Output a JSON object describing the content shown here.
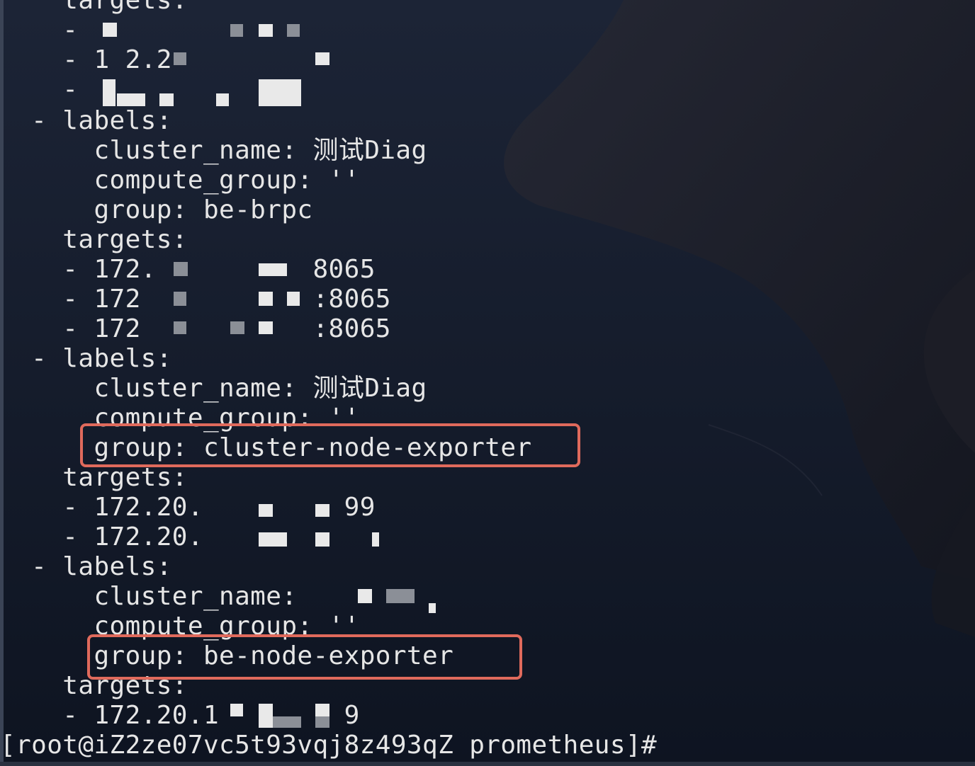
{
  "terminal": {
    "lines": [
      "    targets:",
      "    - ",
      "    - 1 2.2",
      "    - ",
      "  - labels:",
      "      cluster_name: 测试Diag",
      "      compute_group: ''",
      "      group: be-brpc",
      "    targets:",
      "    - 172.          8065",
      "    - 172           :8065",
      "    - 172           :8065",
      "  - labels:",
      "      cluster_name: 测试Diag",
      "      compute_group: ''",
      "      group: cluster-node-exporter",
      "    targets:",
      "    - 172.20.         99",
      "    - 172.20.",
      "  - labels:",
      "      cluster_name:",
      "      compute_group: ''",
      "      group: be-node-exporter",
      "    targets:",
      "    - 172.20.1        9",
      "[root@iZ2ze07vc5t93vqj8z493qZ prometheus]#"
    ]
  },
  "colors": {
    "text": "#e6e6e6",
    "highlight": "#e06a5c",
    "background": "#141c2b"
  }
}
